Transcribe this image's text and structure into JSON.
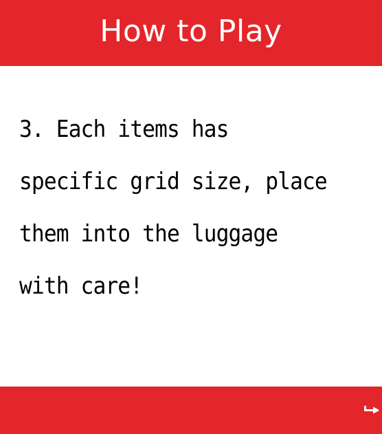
{
  "header": {
    "title": "How to Play"
  },
  "instructions": {
    "lines": [
      "3. Each items has",
      "specific grid size, place",
      "them into the luggage",
      "with care!"
    ]
  },
  "footer": {
    "next_icon": "return-arrow-icon"
  },
  "colors": {
    "primary_red": "#e3262b",
    "background": "#ffffff",
    "text": "#000000"
  }
}
